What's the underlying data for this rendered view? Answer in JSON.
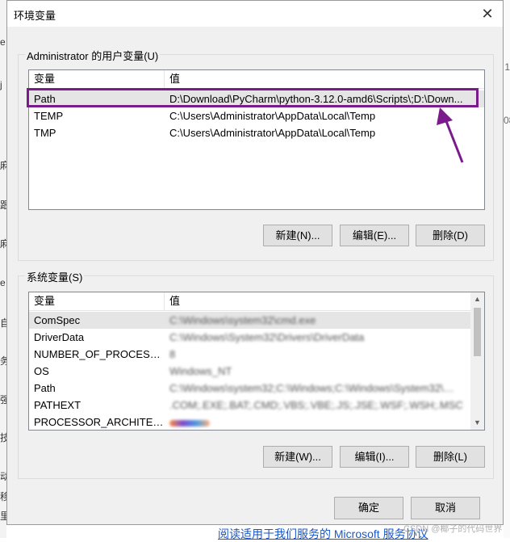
{
  "dialog": {
    "title": "环境变量",
    "close_glyph": "✕"
  },
  "user_vars": {
    "group_label": "Administrator 的用户变量(U)",
    "col_var": "变量",
    "col_val": "值",
    "rows": [
      {
        "name": "Path",
        "value": "D:\\Download\\PyCharm\\python-3.12.0-amd6\\Scripts\\;D:\\Down..."
      },
      {
        "name": "TEMP",
        "value": "C:\\Users\\Administrator\\AppData\\Local\\Temp"
      },
      {
        "name": "TMP",
        "value": "C:\\Users\\Administrator\\AppData\\Local\\Temp"
      }
    ],
    "btn_new": "新建(N)...",
    "btn_edit": "编辑(E)...",
    "btn_delete": "删除(D)"
  },
  "system_vars": {
    "group_label": "系统变量(S)",
    "col_var": "变量",
    "col_val": "值",
    "rows": [
      {
        "name": "ComSpec",
        "value": "C:\\Windows\\system32\\cmd.exe"
      },
      {
        "name": "DriverData",
        "value": "C:\\Windows\\System32\\Drivers\\DriverData"
      },
      {
        "name": "NUMBER_OF_PROCESSORS",
        "value": "8"
      },
      {
        "name": "OS",
        "value": "Windows_NT"
      },
      {
        "name": "Path",
        "value": "C:\\Windows\\system32;C:\\Windows;C:\\Windows\\System32\\Wbem;..."
      },
      {
        "name": "PATHEXT",
        "value": ".COM;.EXE;.BAT;.CMD;.VBS;.VBE;.JS;.JSE;.WSF;.WSH;.MSC"
      },
      {
        "name": "PROCESSOR_ARCHITECT...",
        "value": ""
      }
    ],
    "btn_new": "新建(W)...",
    "btn_edit": "编辑(I)...",
    "btn_delete": "删除(L)"
  },
  "footer": {
    "ok": "确定",
    "cancel": "取消"
  },
  "background": {
    "link_text": "阅读适用于我们服务的 Microsoft 服务协议",
    "watermark": "CSDN @椰子的代码世界",
    "left_glyphs": [
      "e",
      "j",
      "麻",
      "跟",
      "麻",
      "e",
      "自",
      "务",
      "强",
      "技",
      "动",
      "移",
      "里"
    ],
    "right_glyphs": [
      "1",
      "08"
    ]
  },
  "colors": {
    "highlight": "#7b1a8c",
    "dialog_bg": "#f0f0f0",
    "selected_row": "#e5e5e5"
  }
}
